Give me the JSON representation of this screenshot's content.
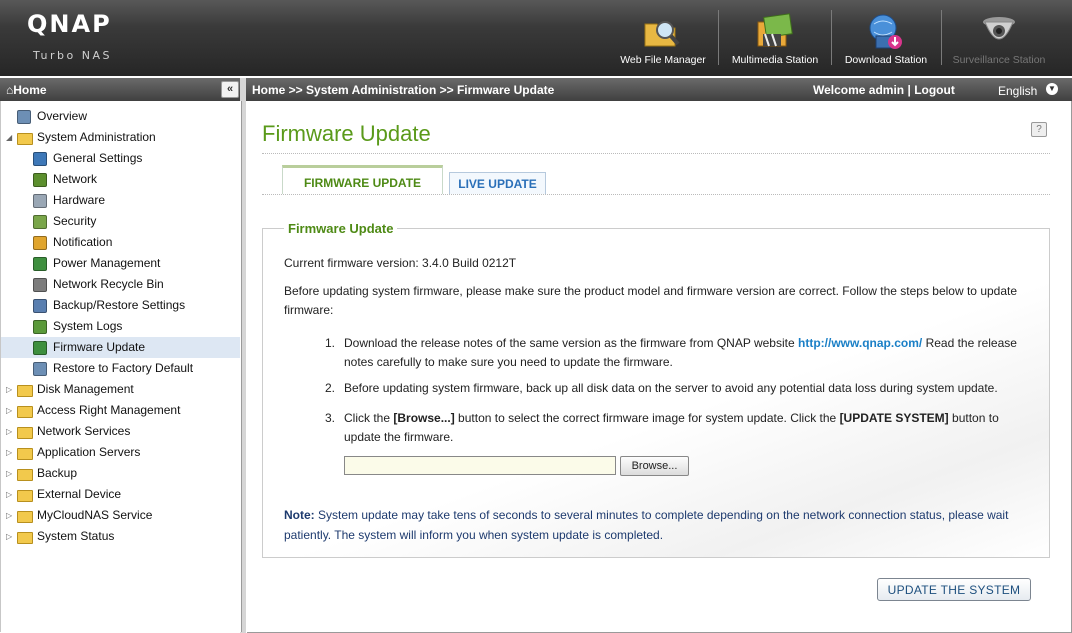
{
  "header": {
    "logo": "QNAP",
    "tagline": "Turbo NAS",
    "apps": [
      {
        "label": "Web File Manager",
        "icon": "web-file-manager-icon"
      },
      {
        "label": "Multimedia Station",
        "icon": "multimedia-station-icon"
      },
      {
        "label": "Download Station",
        "icon": "download-station-icon"
      },
      {
        "label": "Surveillance Station",
        "icon": "surveillance-station-icon"
      }
    ]
  },
  "sidebar": {
    "title": "Home",
    "items": [
      {
        "label": "Overview",
        "icon": "overview-icon"
      },
      {
        "label": "System Administration",
        "icon": "folder-open-icon"
      },
      {
        "label": "General Settings",
        "icon": "general-settings-icon"
      },
      {
        "label": "Network",
        "icon": "network-icon"
      },
      {
        "label": "Hardware",
        "icon": "hardware-icon"
      },
      {
        "label": "Security",
        "icon": "security-icon"
      },
      {
        "label": "Notification",
        "icon": "notification-icon"
      },
      {
        "label": "Power Management",
        "icon": "power-icon"
      },
      {
        "label": "Network Recycle Bin",
        "icon": "recycle-bin-icon"
      },
      {
        "label": "Backup/Restore Settings",
        "icon": "backup-restore-icon"
      },
      {
        "label": "System Logs",
        "icon": "system-logs-icon"
      },
      {
        "label": "Firmware Update",
        "icon": "firmware-icon"
      },
      {
        "label": "Restore to Factory Default",
        "icon": "factory-default-icon"
      },
      {
        "label": "Disk Management",
        "icon": "folder-icon"
      },
      {
        "label": "Access Right Management",
        "icon": "folder-icon"
      },
      {
        "label": "Network Services",
        "icon": "folder-icon"
      },
      {
        "label": "Application Servers",
        "icon": "folder-icon"
      },
      {
        "label": "Backup",
        "icon": "folder-icon"
      },
      {
        "label": "External Device",
        "icon": "folder-icon"
      },
      {
        "label": "MyCloudNAS Service",
        "icon": "folder-icon"
      },
      {
        "label": "System Status",
        "icon": "folder-icon"
      }
    ],
    "selected_label": "Firmware Update"
  },
  "topbar": {
    "breadcrumb": "Home >> System Administration >> Firmware Update",
    "welcome": "Welcome admin",
    "separator": "|",
    "logout": "Logout",
    "language": "English"
  },
  "main": {
    "title": "Firmware Update",
    "help": "?",
    "tabs": [
      {
        "label": "FIRMWARE UPDATE",
        "active": true
      },
      {
        "label": "LIVE UPDATE",
        "active": false
      }
    ],
    "panel": {
      "legend": "Firmware Update",
      "current_version_label": "Current firmware version:",
      "current_version": "3.4.0 Build 0212T",
      "intro": "Before updating system firmware, please make sure the product model and firmware version are correct. Follow the steps below to update firmware:",
      "steps": [
        {
          "num": "1.",
          "text_before": "Download the release notes of the same version as the firmware from QNAP website",
          "link": "http://www.qnap.com/",
          "text_after": "Read the release notes carefully to make sure you need to update the firmware."
        },
        {
          "num": "2.",
          "text": "Before updating system firmware, back up all disk data on the server to avoid any potential data loss during system update."
        },
        {
          "num": "3.",
          "p1": "Click the",
          "b1": "[Browse...]",
          "p2": "button to select the correct firmware image for system update. Click the",
          "b2": "[UPDATE SYSTEM]",
          "p3": "button to update the firmware."
        }
      ],
      "file_value": "",
      "browse_label": "Browse...",
      "note_label": "Note:",
      "note_text": "System update may take tens of seconds to several minutes to complete depending on the network connection status, please wait patiently. The system will inform you when system update is completed."
    },
    "update_button": "UPDATE THE SYSTEM"
  },
  "colors": {
    "title_green": "#5a9a1a",
    "link_blue": "#1a7fc6",
    "note_blue": "#1d3a6e",
    "selected_row": "#dde7f3"
  }
}
